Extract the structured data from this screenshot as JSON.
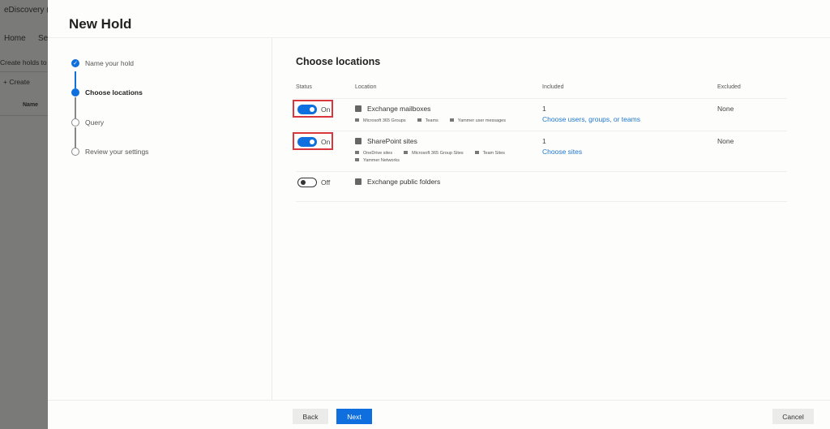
{
  "background": {
    "app_title": "eDiscovery (Sta",
    "nav_home": "Home",
    "nav_se": "Se",
    "description": "Create holds to",
    "create_label": "Create",
    "name_header": "Name"
  },
  "panel": {
    "title": "New Hold"
  },
  "steps": [
    {
      "label": "Name your hold",
      "state": "done"
    },
    {
      "label": "Choose locations",
      "state": "current"
    },
    {
      "label": "Query",
      "state": "pending"
    },
    {
      "label": "Review your settings",
      "state": "pending"
    }
  ],
  "main": {
    "heading": "Choose locations",
    "headers": {
      "status": "Status",
      "location": "Location",
      "included": "Included",
      "excluded": "Excluded"
    },
    "rows": [
      {
        "status": "On",
        "enabled": true,
        "location": "Exchange mailboxes",
        "sub": [
          "Microsoft 365 Groups",
          "Teams",
          "Yammer user messages"
        ],
        "included_count": "1",
        "included_link": "Choose users, groups, or teams",
        "excluded": "None"
      },
      {
        "status": "On",
        "enabled": true,
        "location": "SharePoint sites",
        "sub": [
          "OneDrive sites",
          "Microsoft 365 Group Sites",
          "Team Sites",
          "Yammer Networks"
        ],
        "included_count": "1",
        "included_link": "Choose sites",
        "excluded": "None"
      },
      {
        "status": "Off",
        "enabled": false,
        "location": "Exchange public folders"
      }
    ]
  },
  "footer": {
    "back": "Back",
    "next": "Next",
    "cancel": "Cancel"
  },
  "colors": {
    "accent": "#0f6fde",
    "highlight": "#d9363e",
    "link": "#1f77d0"
  }
}
